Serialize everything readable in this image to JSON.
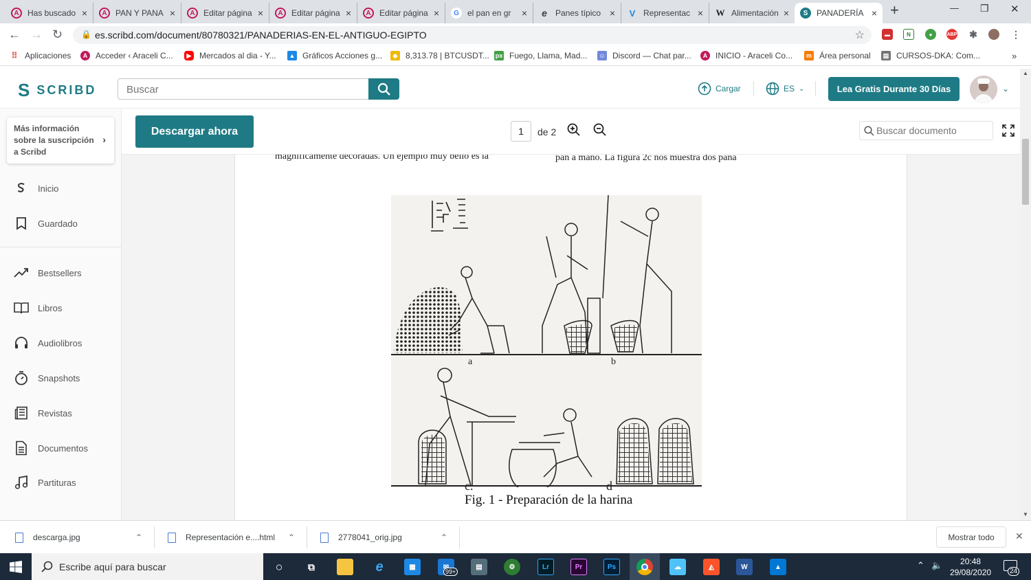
{
  "tabs": [
    {
      "title": "Has buscado",
      "icon": "A",
      "color": "#c2185b"
    },
    {
      "title": "PAN Y PANA",
      "icon": "A",
      "color": "#c2185b"
    },
    {
      "title": "Editar página",
      "icon": "A",
      "color": "#c2185b"
    },
    {
      "title": "Editar página",
      "icon": "A",
      "color": "#c2185b"
    },
    {
      "title": "Editar página",
      "icon": "A",
      "color": "#c2185b"
    },
    {
      "title": "el pan en gr",
      "icon": "G",
      "color": "#4285f4"
    },
    {
      "title": "Panes típico",
      "icon": "e",
      "color": "#3c4043"
    },
    {
      "title": "Representac",
      "icon": "V",
      "color": "#1e88e5"
    },
    {
      "title": "Alimentación",
      "icon": "W",
      "color": "#202124"
    },
    {
      "title": "PANADERÍA",
      "icon": "S",
      "color": "#1e7b85"
    }
  ],
  "tab_new_label": "+",
  "tab_close_label": "×",
  "window_controls": {
    "minimize": "—",
    "restore": "❐",
    "close": "✕"
  },
  "address": {
    "url": "es.scribd.com/document/80780321/PANADERIAS-EN-EL-ANTIGUO-EGIPTO"
  },
  "bookmarks": [
    {
      "label": "Aplicaciones",
      "color": "#ea4335"
    },
    {
      "label": "Acceder ‹ Araceli C...",
      "color": "#c2185b"
    },
    {
      "label": "Mercados al dia - Y...",
      "color": "#ff0000"
    },
    {
      "label": "Gráficos Acciones g...",
      "color": "#1e88e5"
    },
    {
      "label": "8,313.78 | BTCUSDT...",
      "color": "#f0b90b"
    },
    {
      "label": "Fuego, Llama, Mad...",
      "color": "#43a047"
    },
    {
      "label": "Discord — Chat par...",
      "color": "#7289da"
    },
    {
      "label": "INICIO - Araceli Co...",
      "color": "#c2185b"
    },
    {
      "label": "Área personal",
      "color": "#f57c00"
    },
    {
      "label": "CURSOS-DKA: Com...",
      "color": "#757575"
    }
  ],
  "bookmarks_more": "»",
  "header": {
    "logo": "SCRIBD",
    "search_placeholder": "Buscar",
    "upload_label": "Cargar",
    "lang_label": "ES",
    "cta_label": "Lea Gratis Durante 30 Días"
  },
  "sidebar": {
    "promo": "Más información sobre la suscripción a Scribd",
    "items": [
      {
        "label": "Inicio",
        "icon": "scribd-home-icon"
      },
      {
        "label": "Guardado",
        "icon": "bookmark-icon"
      },
      {
        "label": "Bestsellers",
        "icon": "trending-icon"
      },
      {
        "label": "Libros",
        "icon": "book-icon"
      },
      {
        "label": "Audiolibros",
        "icon": "headphones-icon"
      },
      {
        "label": "Snapshots",
        "icon": "stopwatch-icon"
      },
      {
        "label": "Revistas",
        "icon": "magazine-icon"
      },
      {
        "label": "Documentos",
        "icon": "document-icon"
      },
      {
        "label": "Partituras",
        "icon": "music-note-icon"
      }
    ]
  },
  "doc_toolbar": {
    "download_label": "Descargar ahora",
    "page_current": "1",
    "page_total": "de 2",
    "search_placeholder": "Buscar documento"
  },
  "document": {
    "text_left": "magnificamente decoradas. Un ejemplo muy bello es la",
    "text_right": "pan a mano. La figura 2c nos muestra dos pana",
    "label_a": "a",
    "label_b": "b",
    "label_c": "c.",
    "label_d": "d",
    "caption": "Fig. 1 - Preparación de la harina"
  },
  "downloads": [
    {
      "name": "descarga.jpg"
    },
    {
      "name": "Representación e....html"
    },
    {
      "name": "2778041_orig.jpg"
    }
  ],
  "downloads_show_all": "Mostrar todo",
  "taskbar": {
    "search_placeholder": "Escribe aquí para buscar",
    "mail_badge": "99+",
    "time": "20:48",
    "date": "29/08/2020",
    "notif_count": "24"
  }
}
